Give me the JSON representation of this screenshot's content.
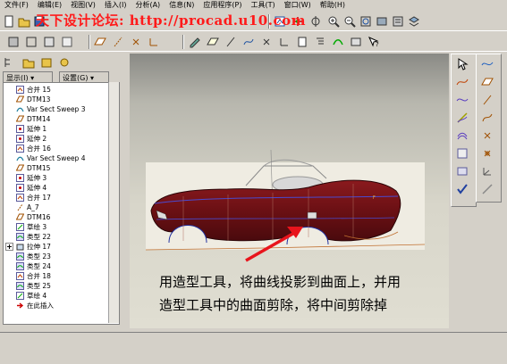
{
  "menu": [
    "文件(F)",
    "编辑(E)",
    "视图(V)",
    "插入(I)",
    "分析(A)",
    "信息(N)",
    "应用程序(P)",
    "工具(T)",
    "窗口(W)",
    "帮助(H)"
  ],
  "watermark": "天下设计论坛: http://procad.u10.com",
  "panel": {
    "show_label": "显示(I) ▾",
    "settings_label": "设置(G) ▾"
  },
  "tree": [
    {
      "label": "合并 15",
      "icon": "merge-icon"
    },
    {
      "label": "DTM13",
      "icon": "datum-plane-icon"
    },
    {
      "label": "Var Sect Sweep 3",
      "icon": "sweep-icon"
    },
    {
      "label": "DTM14",
      "icon": "datum-plane-icon"
    },
    {
      "label": "延伸 1",
      "icon": "extend-icon"
    },
    {
      "label": "延伸 2",
      "icon": "extend-icon"
    },
    {
      "label": "合并 16",
      "icon": "merge-icon"
    },
    {
      "label": "Var Sect Sweep 4",
      "icon": "sweep-icon"
    },
    {
      "label": "DTM15",
      "icon": "datum-plane-icon"
    },
    {
      "label": "延伸 3",
      "icon": "extend-icon"
    },
    {
      "label": "延伸 4",
      "icon": "extend-icon"
    },
    {
      "label": "合并 17",
      "icon": "merge-icon"
    },
    {
      "label": "A_7",
      "icon": "axis-icon"
    },
    {
      "label": "DTM16",
      "icon": "datum-plane-icon"
    },
    {
      "label": "草绘 3",
      "icon": "sketch-icon"
    },
    {
      "label": "类型 22",
      "icon": "style-icon"
    },
    {
      "label": "拉伸 17",
      "icon": "extrude-icon"
    },
    {
      "label": "类型 23",
      "icon": "style-icon"
    },
    {
      "label": "类型 24",
      "icon": "style-icon"
    },
    {
      "label": "合并 18",
      "icon": "merge-icon"
    },
    {
      "label": "类型 25",
      "icon": "style-icon"
    },
    {
      "label": "草绘 4",
      "icon": "sketch-icon"
    },
    {
      "label": "在此插入",
      "icon": "insert-here-icon"
    }
  ],
  "annotation": {
    "line1": "用造型工具，将曲线投影到曲面上，并用",
    "line2": "造型工具中的曲面剪除，将中间剪除掉"
  },
  "colors": {
    "car_body": "#6b1014",
    "annotation_arrow": "#e8141c",
    "watermark": "#ff1a1a"
  }
}
